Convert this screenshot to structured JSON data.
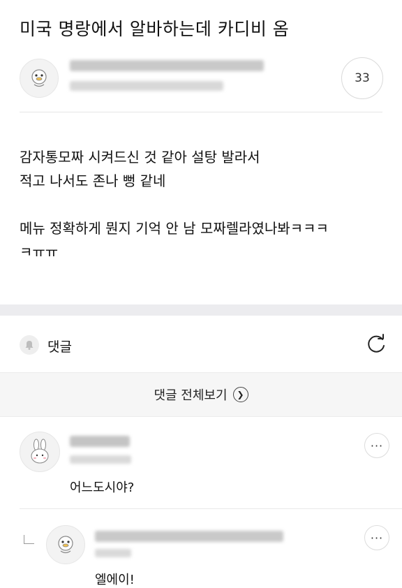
{
  "post": {
    "title": "미국 명랑에서 알바하는데 카디비 옴",
    "comment_count": "33",
    "body_lines": [
      "감자통모짜 시켜드신 것 같아 설탕 발라서",
      "적고 나서도 존나 뻥 같네",
      "",
      "메뉴 정확하게 뭔지 기억 안 남 모짜렐라였나봐ㅋㅋㅋ",
      "ㅋㅠㅠ"
    ]
  },
  "comments_section": {
    "label": "댓글",
    "view_all_label": "댓글 전체보기",
    "icons": [
      "bell-icon",
      "refresh-icon",
      "chevron-right-icon"
    ]
  },
  "comments": [
    {
      "text": "어느도시야?",
      "more": "···"
    },
    {
      "text": "엘에이!",
      "more": "···",
      "is_reply": true
    }
  ]
}
